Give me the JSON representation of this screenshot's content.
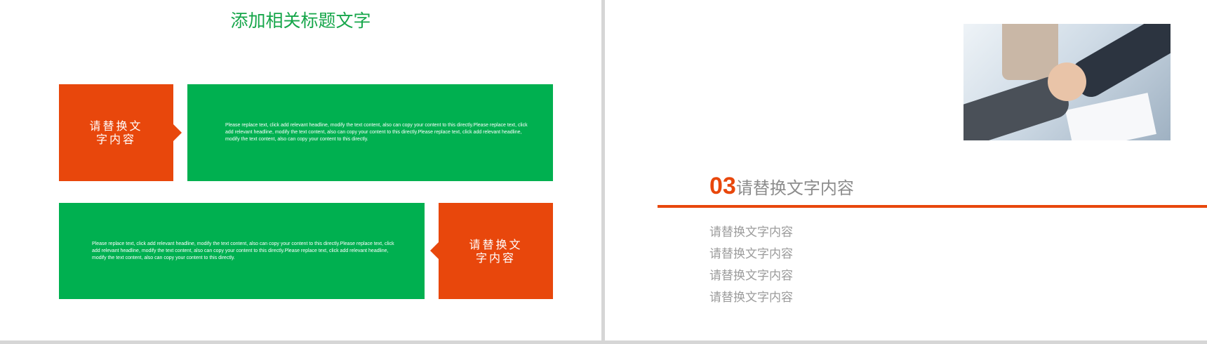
{
  "left_slide": {
    "title": "添加相关标题文字",
    "row1": {
      "label_line1": "请替换文",
      "label_line2": "字内容",
      "body": "Please replace text, click add relevant headline, modify the text content, also can copy your content to this directly.Please replace text, click add relevant headline, modify the text content, also can copy your content to this directly.Please replace text, click add relevant headline, modify the text content, also can copy your content to this directly."
    },
    "row2": {
      "label_line1": "请替换文",
      "label_line2": "字内容",
      "body": "Please replace text, click add relevant headline, modify the text content, also can copy your content to this directly.Please replace text, click add relevant headline, modify the text content, also can copy your content to this directly.Please replace text, click add relevant headline, modify the text content, also can copy your content to this directly."
    }
  },
  "right_slide": {
    "heading_number": "03",
    "heading_text": "请替换文字内容",
    "list_items": [
      "请替换文字内容",
      "请替换文字内容",
      "请替换文字内容",
      "请替换文字内容"
    ]
  },
  "colors": {
    "accent_orange": "#e8470c",
    "accent_green": "#00b050",
    "title_green": "#16a64a"
  }
}
